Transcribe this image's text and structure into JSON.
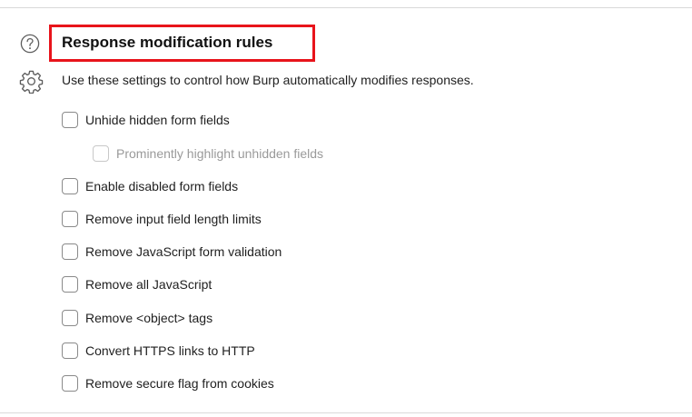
{
  "section": {
    "title": "Response modification rules",
    "description": "Use these settings to control how Burp automatically modifies responses.",
    "highlight_color": "#e8141b",
    "help_icon": "question-mark-circle",
    "settings_icon": "gear"
  },
  "options": [
    {
      "label": "Unhide hidden form fields",
      "checked": false,
      "enabled": true
    },
    {
      "label": "Prominently highlight unhidden fields",
      "checked": false,
      "enabled": false
    },
    {
      "label": "Enable disabled form fields",
      "checked": false,
      "enabled": true
    },
    {
      "label": "Remove input field length limits",
      "checked": false,
      "enabled": true
    },
    {
      "label": "Remove JavaScript form validation",
      "checked": false,
      "enabled": true
    },
    {
      "label": "Remove all JavaScript",
      "checked": false,
      "enabled": true
    },
    {
      "label": "Remove <object> tags",
      "checked": false,
      "enabled": true
    },
    {
      "label": "Convert HTTPS links to HTTP",
      "checked": false,
      "enabled": true
    },
    {
      "label": "Remove secure flag from cookies",
      "checked": false,
      "enabled": true
    }
  ]
}
